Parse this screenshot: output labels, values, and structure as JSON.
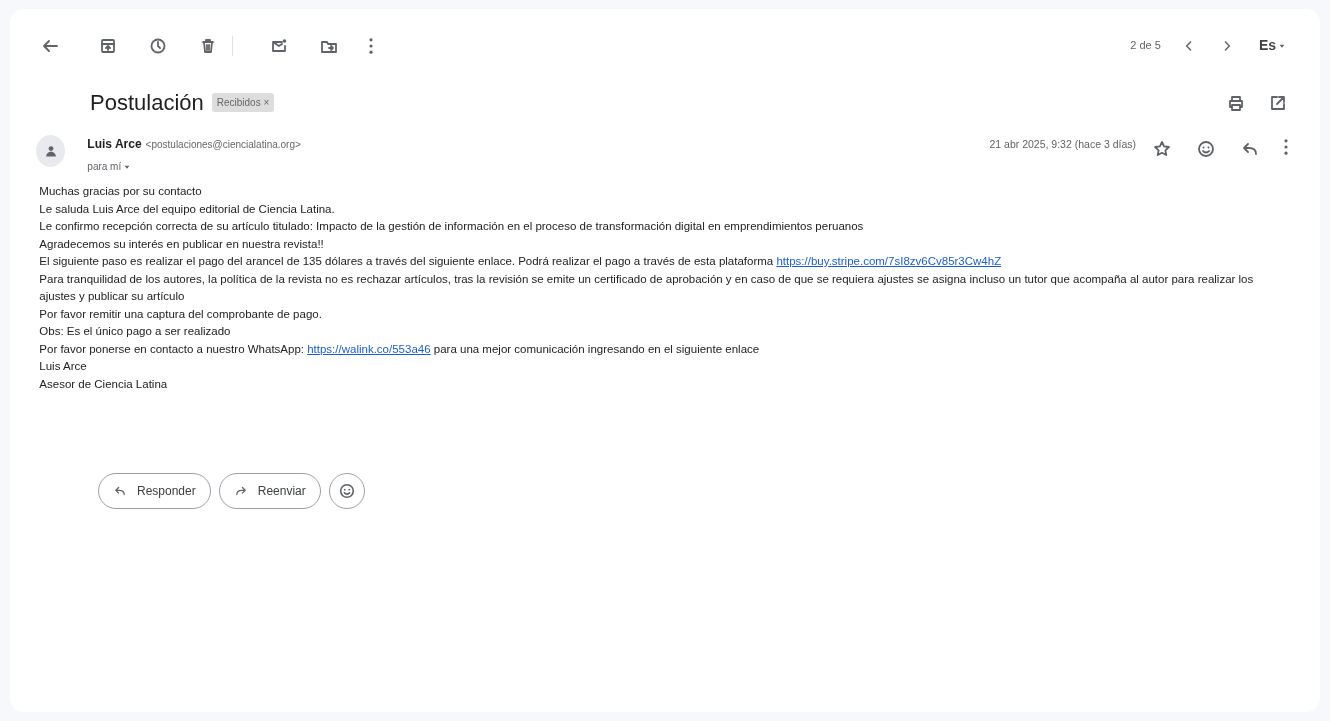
{
  "toolbar": {
    "pager": "2 de 5",
    "language": "Es"
  },
  "subject": "Postulación",
  "labels": [
    {
      "text": "Recibidos",
      "close": "×"
    }
  ],
  "message": {
    "sender_name": "Luis Arce",
    "sender_email": "<postulaciones@ciencialatina.org>",
    "recipient": "para mí",
    "date": "21 abr 2025, 9:32 (hace 3 días)",
    "starred": false,
    "body": [
      [
        {
          "text": "Muchas gracias por su contacto"
        }
      ],
      [
        {
          "text": "Le saluda Luis Arce del equipo editorial de Ciencia Latina."
        }
      ],
      [
        {
          "text": "Le confirmo recepción correcta de su artículo titulado: Impacto de la gestión de información en el proceso de transformación digital en emprendimientos peruanos"
        }
      ],
      [
        {
          "text": "Agradecemos su interés en publicar en nuestra revista!!"
        }
      ],
      [
        {
          "text": "El siguiente paso es realizar el pago del arancel de 135 dólares a través del siguiente enlace. Podrá realizar el pago a través de esta plataforma "
        },
        {
          "link": "https://buy.stripe.com/7sI8zv6Cv85r3Cw4hZ"
        }
      ],
      [
        {
          "text": "Para tranquilidad de los autores, la política de la revista no es rechazar artículos, tras la revisión se emite un certificado de aprobación y en caso de que se requiera ajustes se asigna incluso un tutor que acompaña al autor para realizar los ajustes y publicar su artículo"
        }
      ],
      [
        {
          "text": "Por favor remitir una captura del comprobante de pago."
        }
      ],
      [
        {
          "text": "Obs: Es el único pago a ser realizado"
        }
      ],
      [
        {
          "text": "Por favor ponerse en contacto a nuestro WhatsApp: "
        },
        {
          "link": "https://walink.co/553a46"
        },
        {
          "text": " para una mejor comunicación ingresando en el siguiente enlace"
        }
      ],
      [
        {
          "text": "Luis Arce"
        }
      ],
      [
        {
          "text": "Asesor de Ciencia Latina"
        }
      ]
    ]
  },
  "actions": [
    "Responder",
    "Reenviar"
  ]
}
